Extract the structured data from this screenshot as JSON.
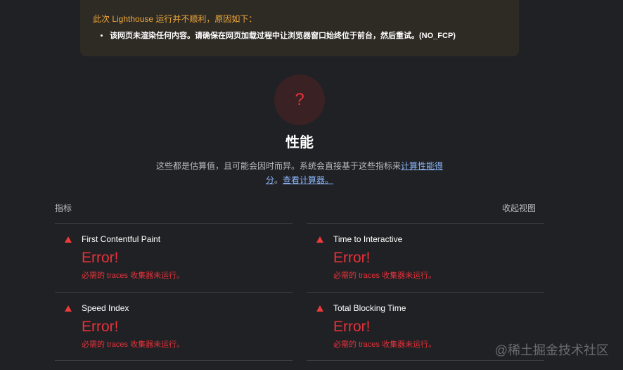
{
  "warning": {
    "title": "此次 Lighthouse 运行并不顺利，原因如下：",
    "items": [
      "该网页未渲染任何内容。请确保在网页加载过程中让浏览器窗口始终位于前台，然后重试。(NO_FCP)"
    ]
  },
  "category": {
    "gauge_label": "?",
    "title": "性能",
    "description_text_1": "这些都是估算值，且可能会因时而异。系统会直接基于这些指标来",
    "description_link_1": "计算性能得分",
    "description_text_2": "。",
    "description_link_2": "查看计算器。"
  },
  "metrics_header": {
    "label": "指标",
    "toggle": "收起视图"
  },
  "metrics": [
    {
      "title": "First Contentful Paint",
      "value": "Error!",
      "description": "必需的 traces 收集器未运行。"
    },
    {
      "title": "Time to Interactive",
      "value": "Error!",
      "description": "必需的 traces 收集器未运行。"
    },
    {
      "title": "Speed Index",
      "value": "Error!",
      "description": "必需的 traces 收集器未运行。"
    },
    {
      "title": "Total Blocking Time",
      "value": "Error!",
      "description": "必需的 traces 收集器未运行。"
    }
  ],
  "colors": {
    "error": "#e8313a",
    "warning": "#f0a83a",
    "link": "#8ab4f8"
  },
  "watermark": "@稀土掘金技术社区"
}
